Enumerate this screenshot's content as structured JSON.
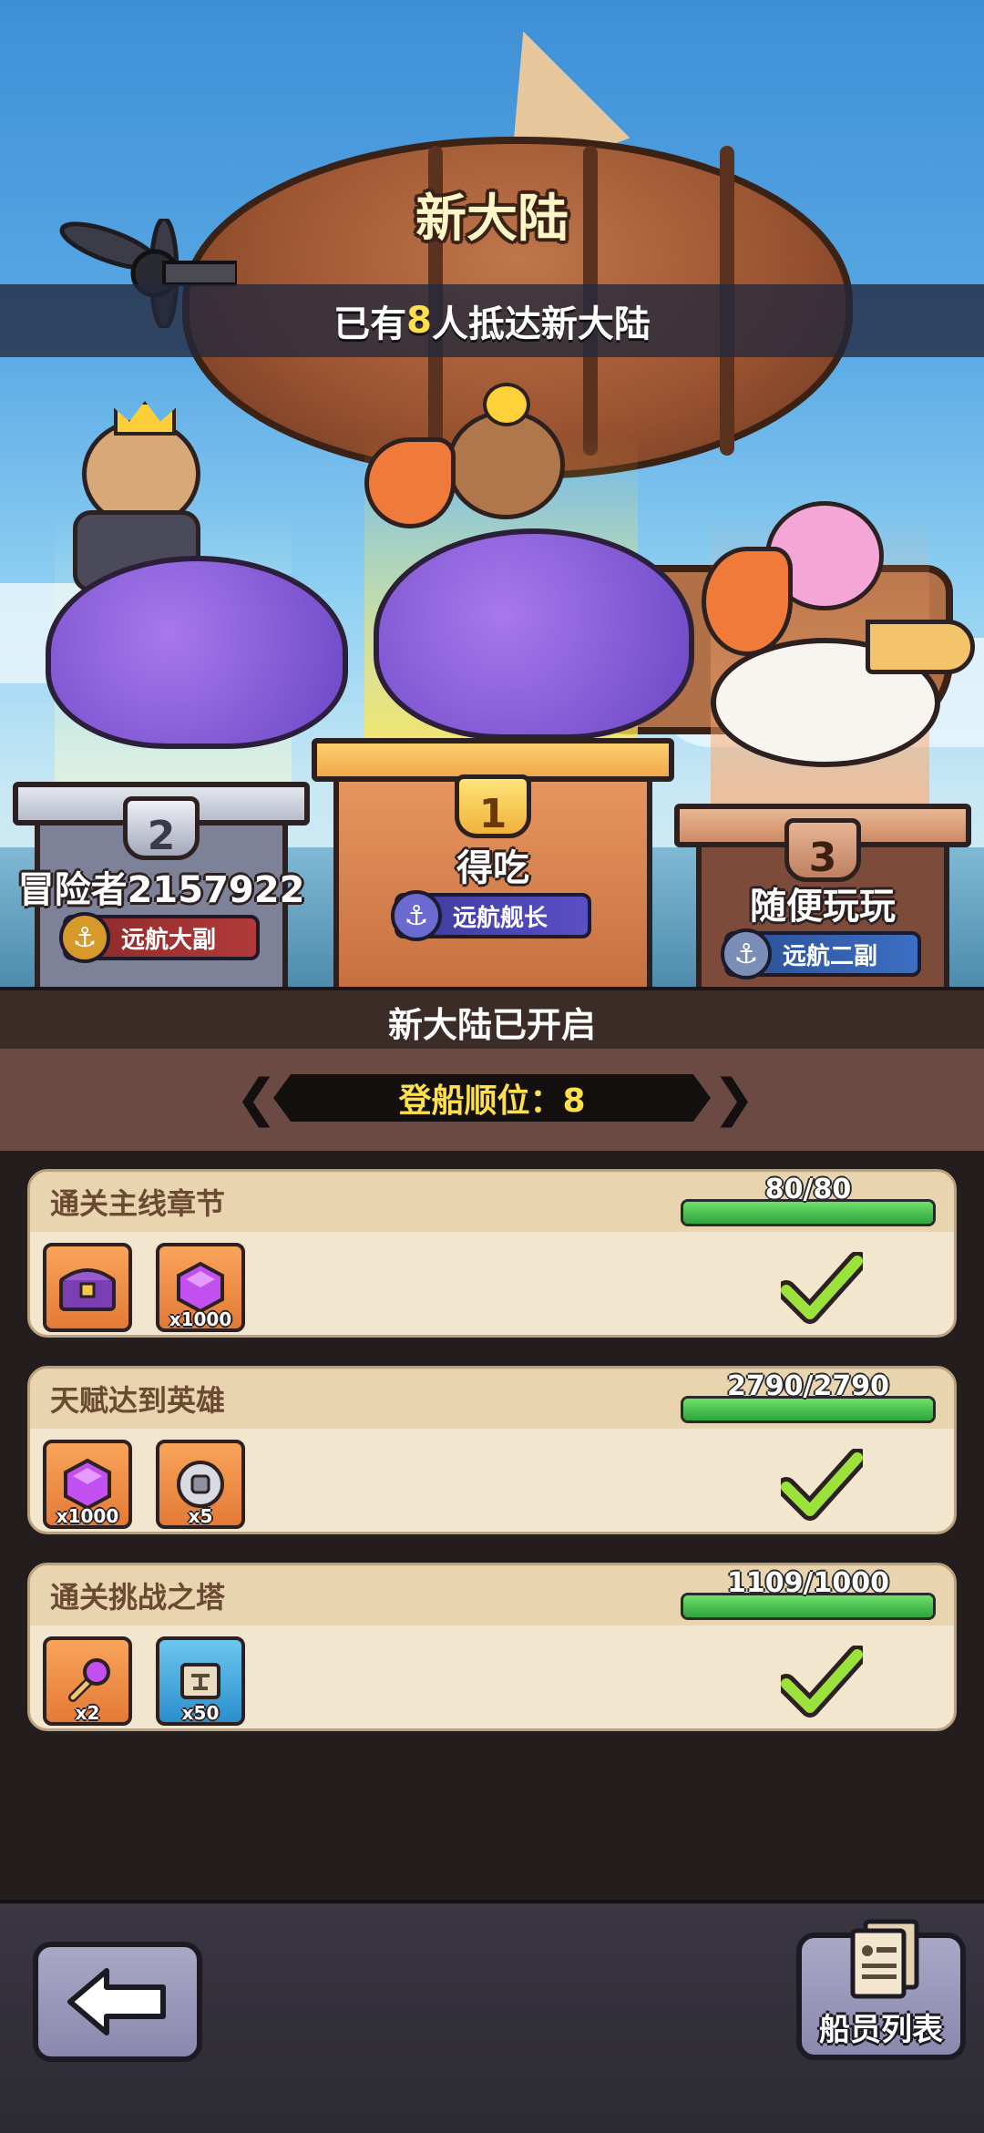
{
  "header": {
    "title": "新大陆",
    "arrival_prefix": "已有",
    "arrival_count": "8",
    "arrival_suffix": "人抵达新大陆"
  },
  "podiums": [
    {
      "rank": "2",
      "name": "冒险者2157922",
      "title": "远航大副"
    },
    {
      "rank": "1",
      "name": "得吃",
      "title": "远航舰长"
    },
    {
      "rank": "3",
      "name": "随便玩玩",
      "title": "远航二副"
    }
  ],
  "status": {
    "opened_label": "新大陆已开启",
    "boarding_order": "登船顺位：8"
  },
  "tasks": [
    {
      "name": "通关主线章节",
      "progress_text": "80/80",
      "progress": 1.0,
      "rewards": [
        {
          "icon": "treasure-chest-icon",
          "count": ""
        },
        {
          "icon": "purple-gem-icon",
          "count": "x1000"
        }
      ]
    },
    {
      "name": "天赋达到英雄",
      "progress_text": "2790/2790",
      "progress": 1.0,
      "rewards": [
        {
          "icon": "purple-gem-icon",
          "count": "x1000"
        },
        {
          "icon": "silver-coin-icon",
          "count": "x5"
        }
      ]
    },
    {
      "name": "通关挑战之塔",
      "progress_text": "1109/1000",
      "progress": 1.0,
      "rewards": [
        {
          "icon": "magic-wand-icon",
          "count": "x2"
        },
        {
          "icon": "scroll-icon",
          "count": "x50"
        }
      ]
    }
  ],
  "footer": {
    "crew_list_label": "船员列表"
  },
  "colors": {
    "highlight": "#ffe04a",
    "progress_green": "#3cc04a",
    "card_bg": "#f3e6cf"
  }
}
